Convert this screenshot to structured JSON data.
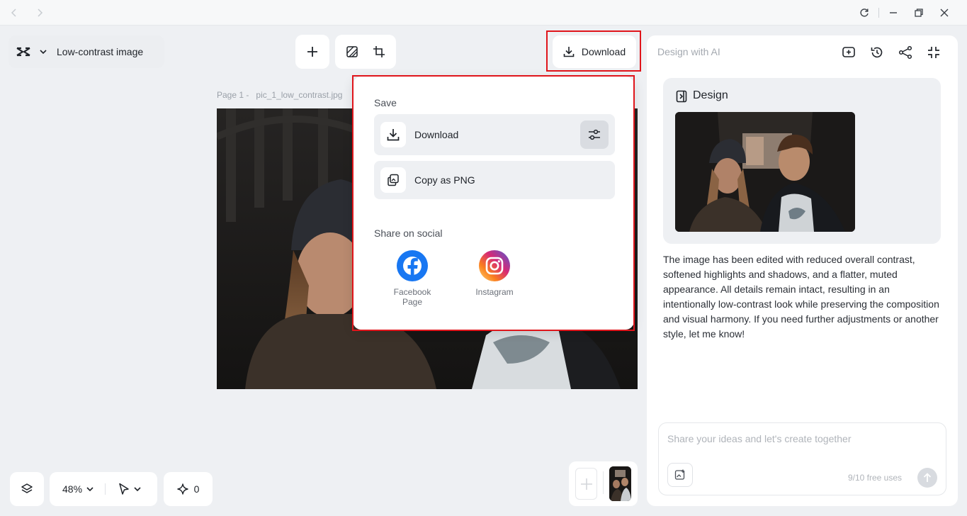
{
  "app": {
    "project_title": "Low-contrast image"
  },
  "toolbar": {
    "download_label": "Download"
  },
  "canvas": {
    "page_label": "Page 1 -",
    "file_name": "pic_1_low_contrast.jpg"
  },
  "download_menu": {
    "save_section_title": "Save",
    "download_label": "Download",
    "copy_png_label": "Copy as PNG",
    "share_section_title": "Share on social",
    "social": [
      {
        "label_line1": "Facebook",
        "label_line2": "Page",
        "icon": "facebook-icon"
      },
      {
        "label_line1": "Instagram",
        "label_line2": "",
        "icon": "instagram-icon"
      }
    ]
  },
  "ai_panel": {
    "title": "Design with AI",
    "design_card_title": "Design",
    "message": "The image has been edited with reduced overall contrast, softened highlights and shadows, and a flatter, muted appearance. All details remain intact, resulting in an intentionally low-contrast look while preserving the composition and visual harmony. If you need further adjustments or another style, let me know!",
    "input_placeholder": "Share your ideas and let's create together",
    "free_uses": "9/10 free uses"
  },
  "bottom": {
    "zoom_level": "48%",
    "ai_credits": "0"
  },
  "colors": {
    "highlight_box": "#e0151b",
    "facebook": "#1877f2",
    "panel_bg": "#eef0f3"
  }
}
